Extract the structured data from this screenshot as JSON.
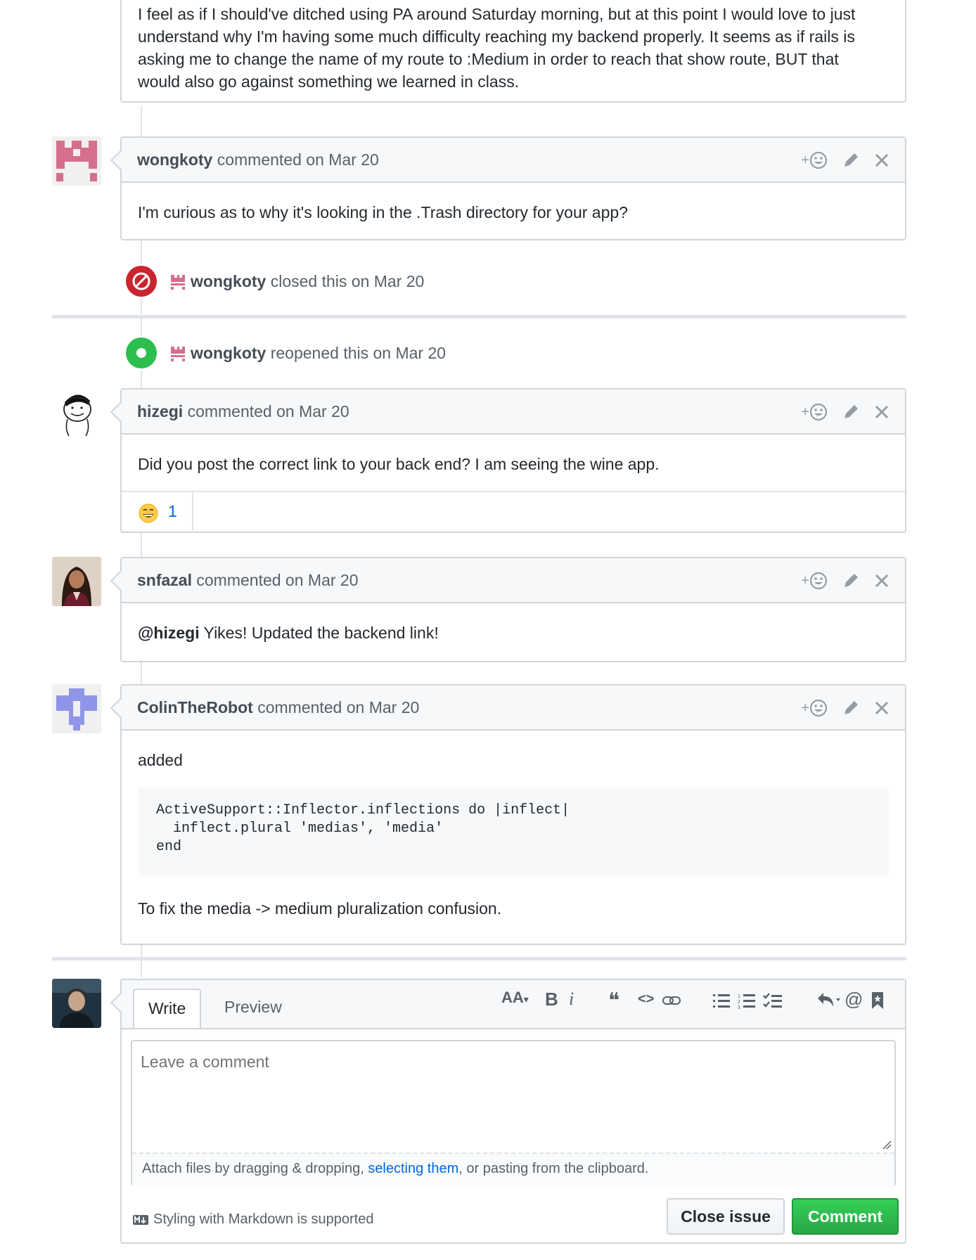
{
  "top_comment": {
    "lines": [
      "I feel as if I should've ditched using PA around Saturday morning, but at this point I would love to just",
      "understand why I'm having some much difficulty reaching my backend properly. It seems as if rails is",
      "asking me to change the name of my route to :Medium in order to reach that show route, BUT that",
      "would also go against something we learned in class."
    ]
  },
  "comments": [
    {
      "author": "wongkoty",
      "meta": "commented on Mar 20",
      "body": "I'm curious as to why it's looking in the .Trash directory for your app?"
    },
    {
      "author": "hizegi",
      "meta": "commented on Mar 20",
      "body": "Did you post the correct link to your back end? I am seeing the wine app.",
      "reaction_count": "1"
    },
    {
      "author": "snfazal",
      "meta": "commented on Mar 20",
      "mention": "@hizegi",
      "body": " Yikes! Updated the backend link!"
    },
    {
      "author": "ColinTheRobot",
      "meta": "commented on Mar 20",
      "intro": "added",
      "code": [
        "ActiveSupport::Inflector.inflections do |inflect|",
        "  inflect.plural 'medias', 'media'",
        "end"
      ],
      "outro": "To fix the media -> medium pluralization confusion."
    }
  ],
  "events": [
    {
      "actor": "wongkoty",
      "action": "closed this on Mar 20",
      "kind": "closed",
      "color": "#cb2431"
    },
    {
      "actor": "wongkoty",
      "action": "reopened this on Mar 20",
      "kind": "reopened",
      "color": "#2cbe4e"
    }
  ],
  "composer": {
    "tabs": [
      "Write",
      "Preview"
    ],
    "placeholder": "Leave a comment",
    "attach_prefix": "Attach files by dragging & dropping, ",
    "attach_link": "selecting them",
    "attach_suffix": ", or pasting from the clipboard.",
    "markdown_note": "Styling with Markdown is supported",
    "close_label": "Close issue",
    "comment_label": "Comment",
    "toolbar": {
      "heading": "AA",
      "bold": "B",
      "italic": "i",
      "quote": "❝",
      "code": "<>",
      "link": "🔗",
      "ul": "☰",
      "ol": "☷",
      "task": "☑",
      "reply": "↶",
      "mention": "@",
      "bookmark": "bookmark"
    }
  },
  "header_plus": "+"
}
